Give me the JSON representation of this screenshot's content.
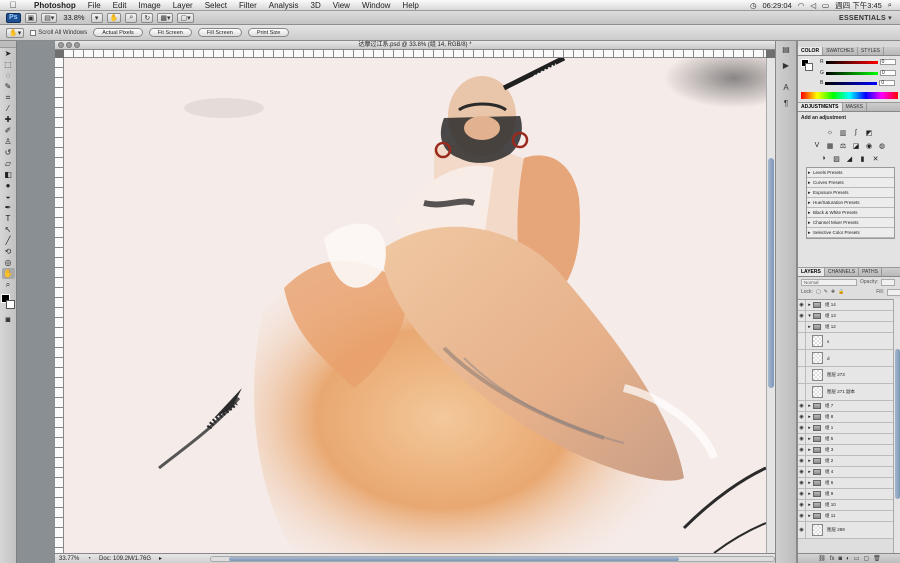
{
  "menubar": {
    "app_name": "Photoshop",
    "items": [
      "File",
      "Edit",
      "Image",
      "Layer",
      "Select",
      "Filter",
      "Analysis",
      "3D",
      "View",
      "Window",
      "Help"
    ],
    "clock": "06:29:04",
    "datetime": "週四 下午3:45"
  },
  "appbar": {
    "ps_logo": "Ps",
    "zoom": "33.8%",
    "workspace": "ESSENTIALS ▾"
  },
  "options": {
    "scroll_all_windows": "Scroll All Windows",
    "buttons": [
      "Actual Pixels",
      "Fit Screen",
      "Fill Screen",
      "Print Size"
    ]
  },
  "document": {
    "tab_title": "达摩过江系.psd @ 33.8% (组 14, RGB/8) *",
    "zoom_status": "33.77%",
    "doc_info": "Doc: 109.2M/1.76G"
  },
  "color_panel": {
    "tabs": [
      "COLOR",
      "SWATCHES",
      "STYLES"
    ],
    "channels": [
      {
        "label": "R",
        "value": "0",
        "color": "#e02020"
      },
      {
        "label": "G",
        "value": "0",
        "color": "#20c020"
      },
      {
        "label": "B",
        "value": "0",
        "color": "#2040e0"
      }
    ]
  },
  "adjustments_panel": {
    "tabs": [
      "ADJUSTMENTS",
      "MASKS"
    ],
    "title": "Add an adjustment",
    "presets": [
      "Levels Presets",
      "Curves Presets",
      "Exposure Presets",
      "Hue/Saturation Presets",
      "Black & White Presets",
      "Channel Mixer Presets",
      "Selective Color Presets"
    ]
  },
  "layers_panel": {
    "tabs": [
      "LAYERS",
      "CHANNELS",
      "PATHS"
    ],
    "blend_mode": "Normal",
    "opacity_label": "Opacity:",
    "lock_label": "Lock:",
    "fill_label": "Fill:",
    "layers": [
      {
        "name": "组 14",
        "type": "group",
        "visible": true,
        "expanded": false
      },
      {
        "name": "组 13",
        "type": "group",
        "visible": true,
        "expanded": true
      },
      {
        "name": "组 12",
        "type": "group",
        "visible": false,
        "expanded": false
      },
      {
        "name": "s",
        "type": "layer",
        "visible": false
      },
      {
        "name": "d",
        "type": "layer",
        "visible": false
      },
      {
        "name": "图层 273",
        "type": "layer",
        "visible": false
      },
      {
        "name": "图层 271 副本",
        "type": "layer",
        "visible": false
      },
      {
        "name": "组 7",
        "type": "group",
        "visible": true,
        "expanded": false
      },
      {
        "name": "组 8",
        "type": "group",
        "visible": true,
        "expanded": false
      },
      {
        "name": "组 1",
        "type": "group",
        "visible": true,
        "expanded": false
      },
      {
        "name": "组 5",
        "type": "group",
        "visible": true,
        "expanded": false
      },
      {
        "name": "组 3",
        "type": "group",
        "visible": true,
        "expanded": false
      },
      {
        "name": "组 2",
        "type": "group",
        "visible": true,
        "expanded": false
      },
      {
        "name": "组 4",
        "type": "group",
        "visible": true,
        "expanded": false
      },
      {
        "name": "组 6",
        "type": "group",
        "visible": true,
        "expanded": false
      },
      {
        "name": "组 9",
        "type": "group",
        "visible": true,
        "expanded": false
      },
      {
        "name": "组 10",
        "type": "group",
        "visible": true,
        "expanded": false
      },
      {
        "name": "组 11",
        "type": "group",
        "visible": true,
        "expanded": false
      },
      {
        "name": "图层 289",
        "type": "layer",
        "visible": true
      }
    ]
  }
}
